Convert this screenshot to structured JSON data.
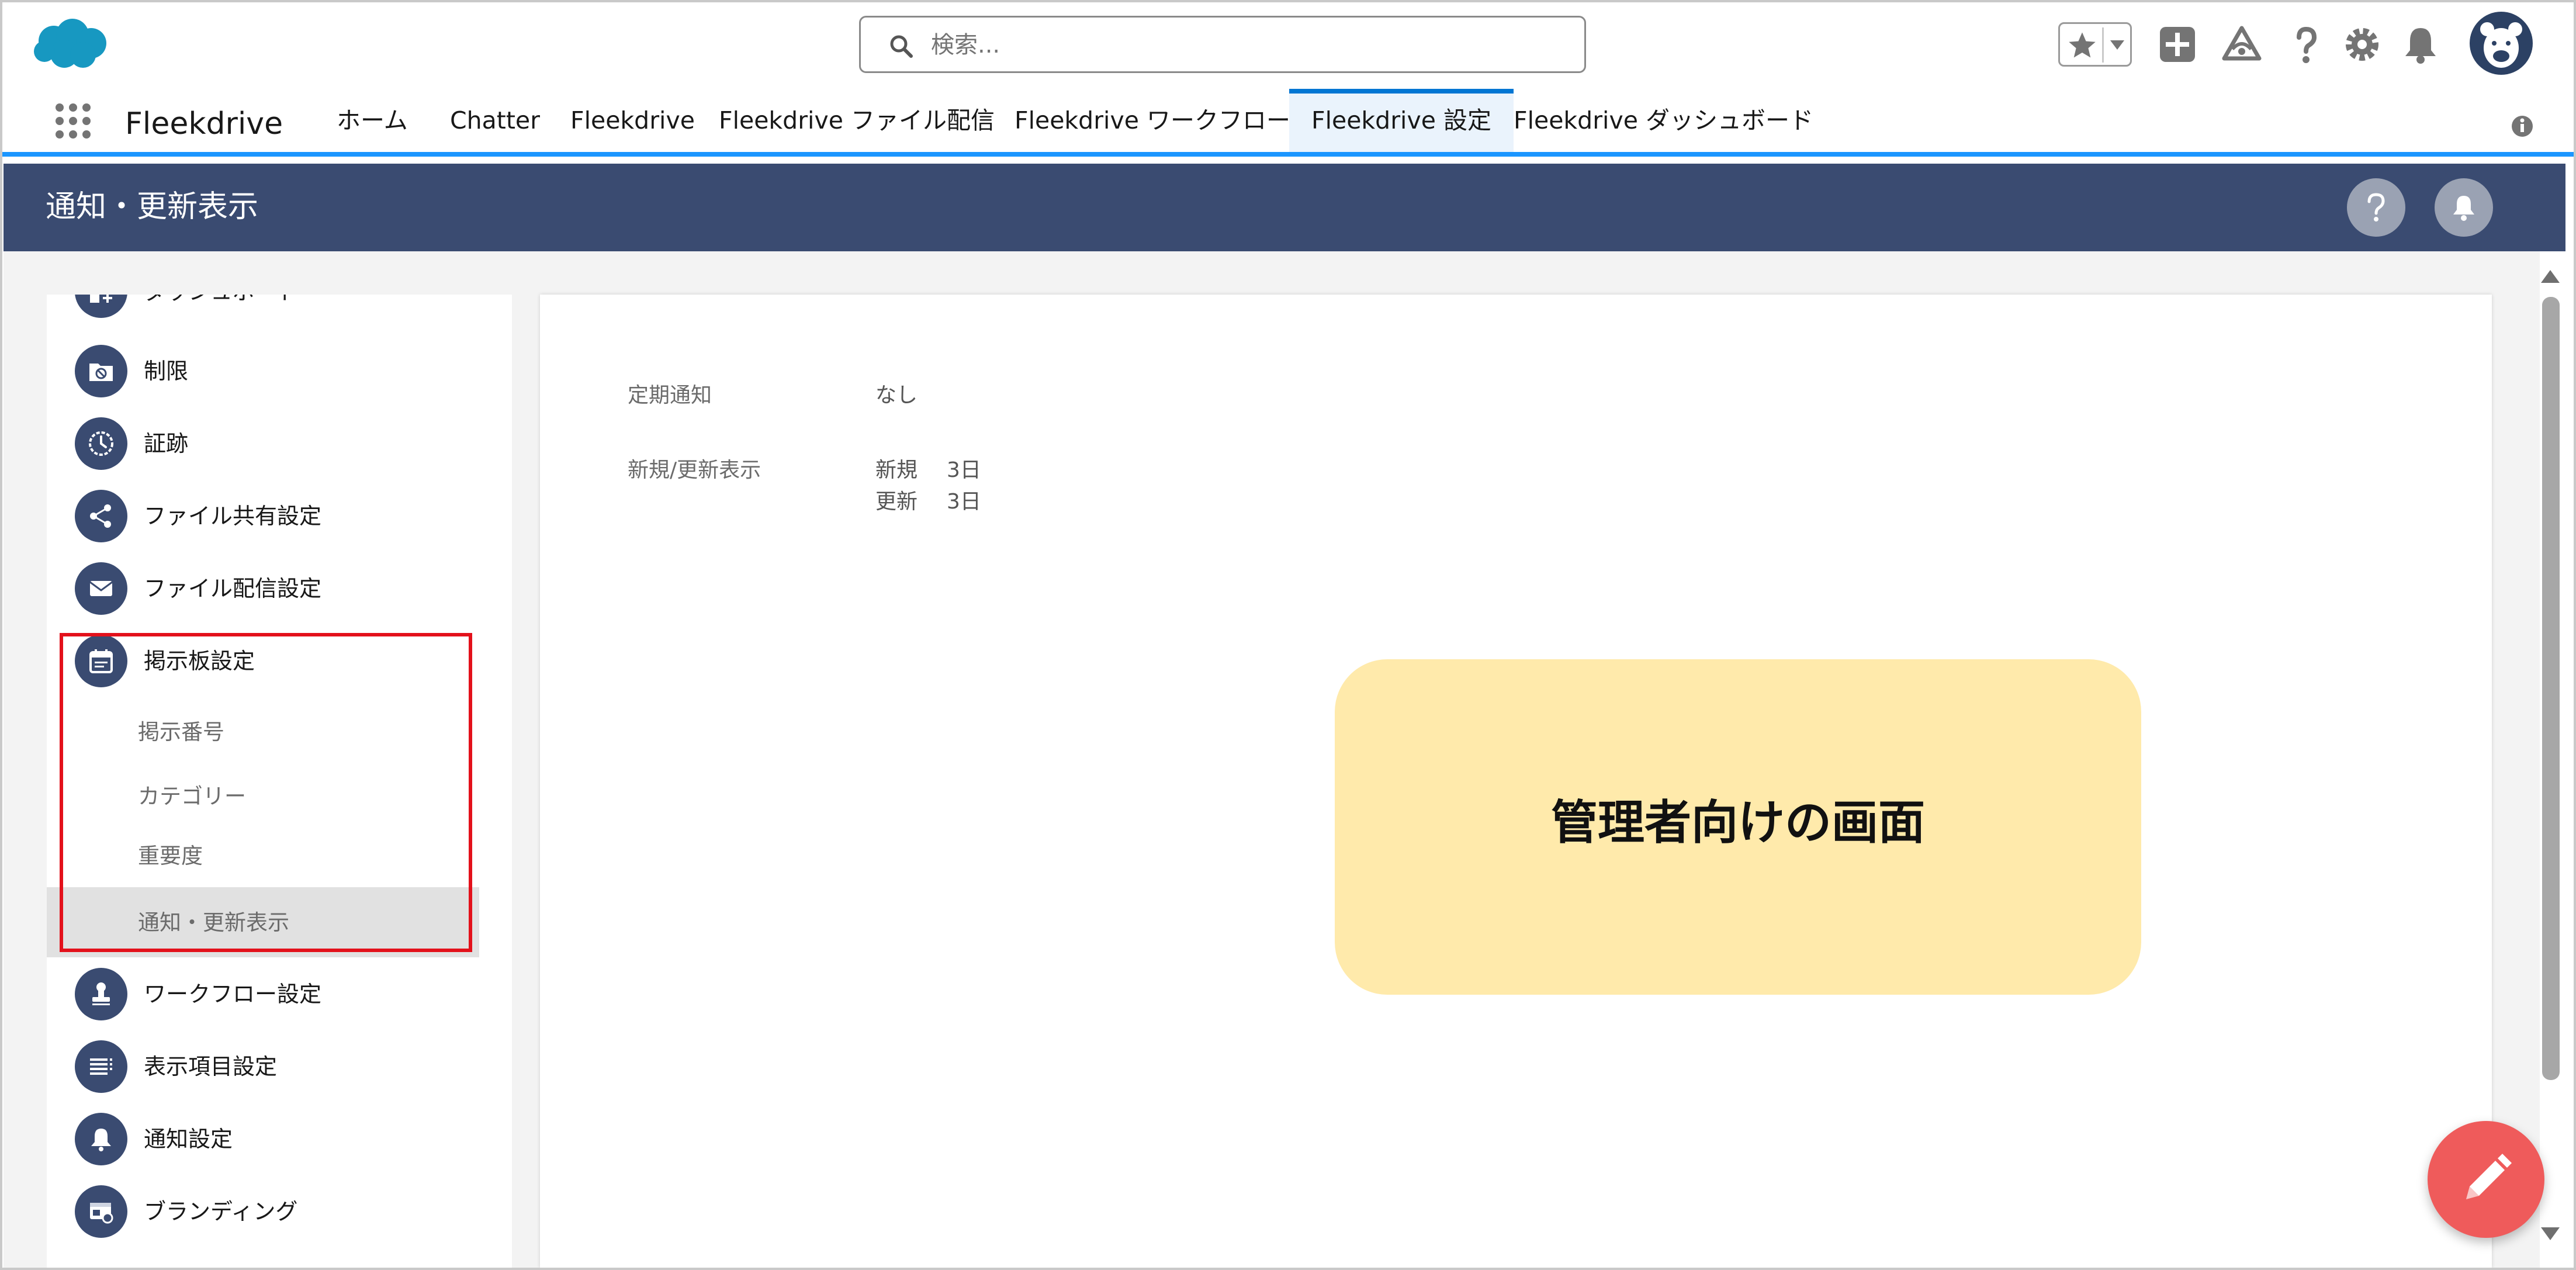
{
  "header": {
    "search_placeholder": "検索..."
  },
  "nav": {
    "app_name": "Fleekdrive",
    "tabs": [
      {
        "label": "ホーム"
      },
      {
        "label": "Chatter"
      },
      {
        "label": "Fleekdrive"
      },
      {
        "label": "Fleekdrive ファイル配信"
      },
      {
        "label": "Fleekdrive ワークフロー"
      },
      {
        "label": "Fleekdrive 設定",
        "active": true
      },
      {
        "label": "Fleekdrive ダッシュボード"
      }
    ]
  },
  "page": {
    "title": "通知・更新表示"
  },
  "sidebar": {
    "items": [
      {
        "label": "ダッシュボード",
        "icon": "dashboard-icon"
      },
      {
        "label": "制限",
        "icon": "folder-restrict-icon"
      },
      {
        "label": "証跡",
        "icon": "clock-icon"
      },
      {
        "label": "ファイル共有設定",
        "icon": "share-icon"
      },
      {
        "label": "ファイル配信設定",
        "icon": "mail-icon"
      },
      {
        "label": "掲示板設定",
        "icon": "calendar-icon"
      },
      {
        "label": "ワークフロー設定",
        "icon": "stamp-icon"
      },
      {
        "label": "表示項目設定",
        "icon": "list-icon"
      },
      {
        "label": "通知設定",
        "icon": "bell-icon"
      },
      {
        "label": "ブランディング",
        "icon": "branding-icon"
      }
    ],
    "subitems": [
      {
        "label": "掲示番号"
      },
      {
        "label": "カテゴリー"
      },
      {
        "label": "重要度"
      },
      {
        "label": "通知・更新表示",
        "selected": true
      }
    ]
  },
  "main": {
    "fields": {
      "periodic": {
        "label": "定期通知",
        "value": "なし"
      },
      "newupdate": {
        "label": "新規/更新表示",
        "new_label": "新規",
        "new_value": "3日",
        "update_label": "更新",
        "update_value": "3日"
      }
    },
    "note": "管理者向けの画面"
  },
  "colors": {
    "brand": "#0176d3",
    "page_header": "#3a4b71",
    "highlight": "#e3111b",
    "note_bg": "#ffeaab",
    "fab": "#ef5b5b"
  }
}
